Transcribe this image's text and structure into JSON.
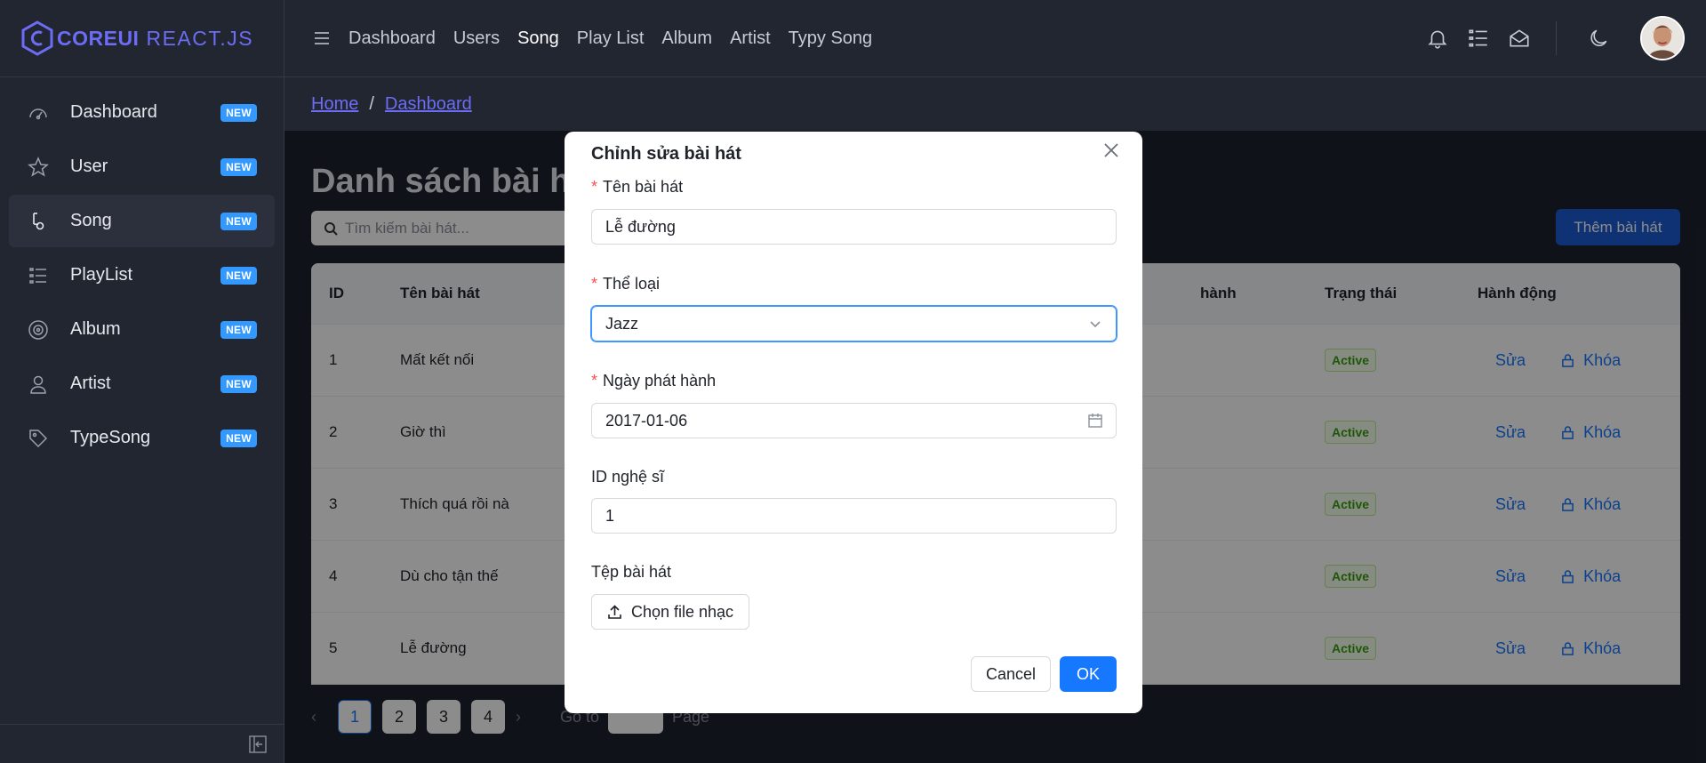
{
  "brand": {
    "name_bold": "COREUI",
    "name_light": "REACT.JS"
  },
  "sidebar": {
    "items": [
      {
        "label": "Dashboard",
        "badge": "NEW",
        "icon": "speedometer-icon"
      },
      {
        "label": "User",
        "badge": "NEW",
        "icon": "star-icon"
      },
      {
        "label": "Song",
        "badge": "NEW",
        "icon": "music-note-icon",
        "active": true
      },
      {
        "label": "PlayList",
        "badge": "NEW",
        "icon": "list-icon"
      },
      {
        "label": "Album",
        "badge": "NEW",
        "icon": "disc-icon"
      },
      {
        "label": "Artist",
        "badge": "NEW",
        "icon": "person-icon"
      },
      {
        "label": "TypeSong",
        "badge": "NEW",
        "icon": "tag-icon"
      }
    ]
  },
  "header": {
    "nav": [
      "Dashboard",
      "Users",
      "Song",
      "Play List",
      "Album",
      "Artist",
      "Typy Song"
    ],
    "active_nav": "Song"
  },
  "breadcrumb": {
    "home": "Home",
    "separator": "/",
    "current": "Dashboard"
  },
  "main": {
    "title": "Danh sách bài hát",
    "search_placeholder": "Tìm kiếm bài hát...",
    "add_button": "Thêm bài hát",
    "columns": {
      "id": "ID",
      "name": "Tên bài hát",
      "date": "hành",
      "status": "Trạng thái",
      "action": "Hành động"
    },
    "rows": [
      {
        "id": "1",
        "name": "Mất kết nối",
        "status": "Active",
        "edit": "Sửa",
        "lock": "Khóa"
      },
      {
        "id": "2",
        "name": "Giờ thì",
        "status": "Active",
        "edit": "Sửa",
        "lock": "Khóa"
      },
      {
        "id": "3",
        "name": "Thích quá rồi nà",
        "status": "Active",
        "edit": "Sửa",
        "lock": "Khóa"
      },
      {
        "id": "4",
        "name": "Dù cho tận thế",
        "status": "Active",
        "edit": "Sửa",
        "lock": "Khóa"
      },
      {
        "id": "5",
        "name": "Lễ đường",
        "status": "Active",
        "edit": "Sửa",
        "lock": "Khóa"
      }
    ],
    "pagination": {
      "pages": [
        "1",
        "2",
        "3",
        "4"
      ],
      "current": "1",
      "goto_label": "Go to",
      "page_label": "Page"
    }
  },
  "modal": {
    "title": "Chỉnh sửa bài hát",
    "fields": {
      "name": {
        "label": "Tên bài hát",
        "value": "Lễ đường"
      },
      "genre": {
        "label": "Thể loại",
        "value": "Jazz"
      },
      "release_date": {
        "label": "Ngày phát hành",
        "value": "2017-01-06"
      },
      "artist_id": {
        "label": "ID nghệ sĩ",
        "value": "1"
      },
      "file": {
        "label": "Tệp bài hát",
        "button": "Chọn file nhạc"
      }
    },
    "cancel": "Cancel",
    "ok": "OK"
  },
  "colors": {
    "accent": "#1677ff",
    "brand": "#6c6cf5",
    "badge": "#3399ff",
    "sidebar_bg": "#212631"
  }
}
